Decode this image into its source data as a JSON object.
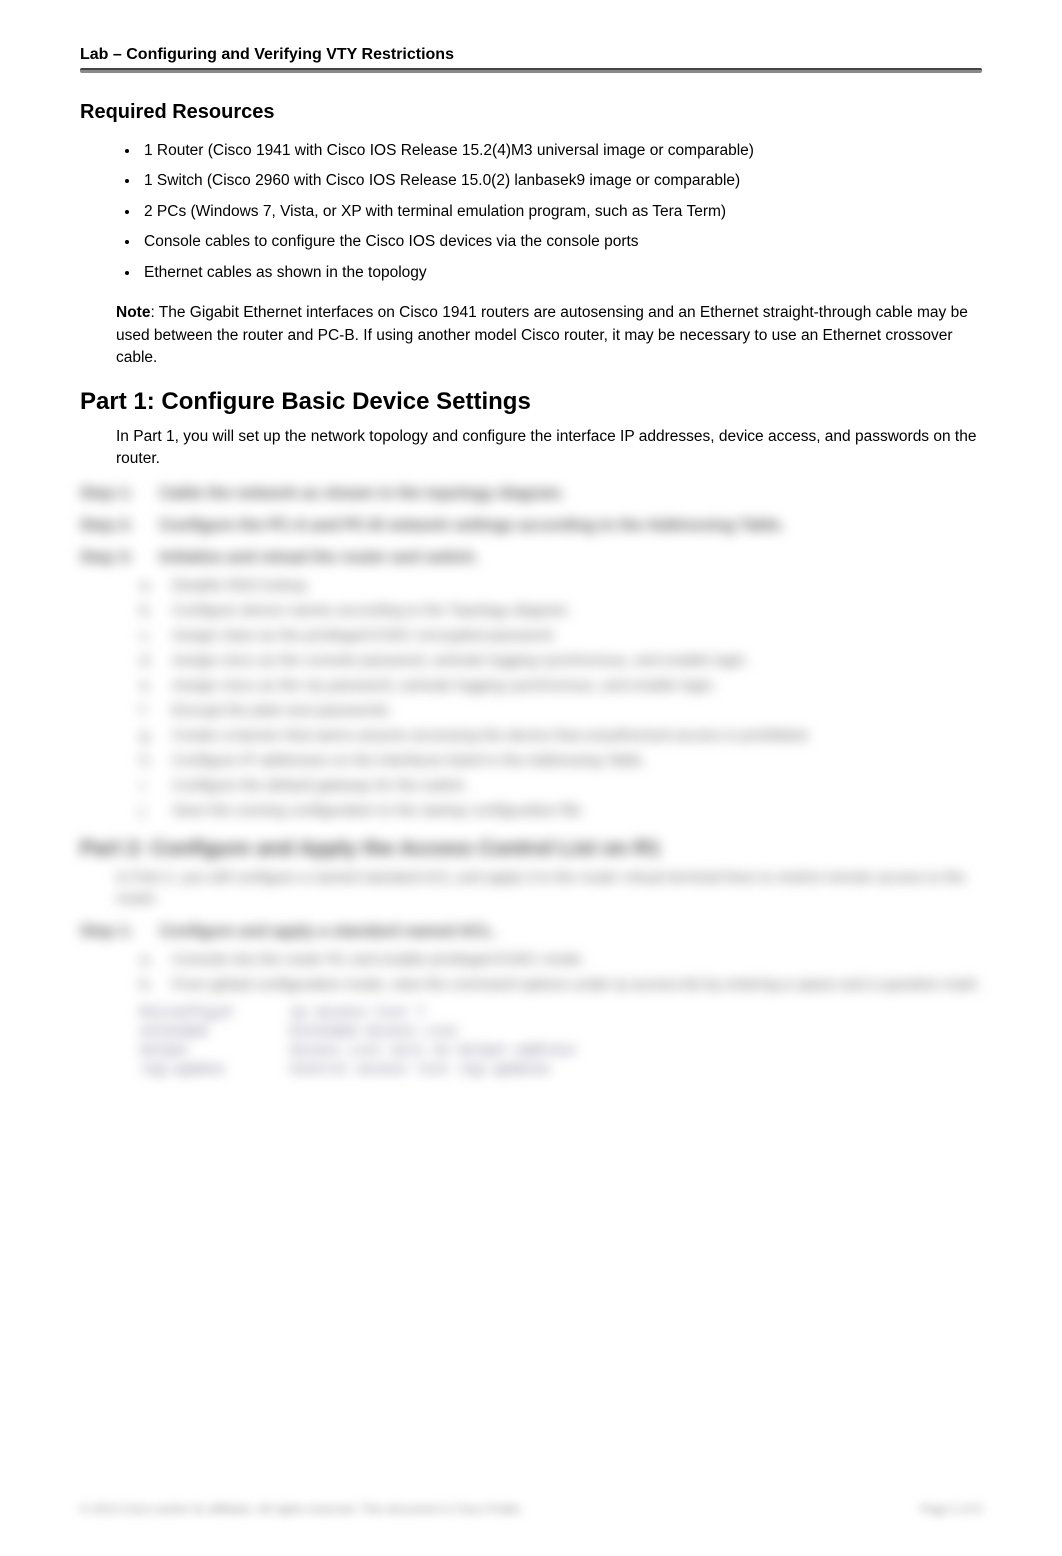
{
  "header": {
    "running_title": "Lab – Configuring and Verifying VTY Restrictions"
  },
  "sections": {
    "resources_heading": "Required Resources",
    "resources": [
      "1 Router (Cisco 1941 with Cisco IOS Release 15.2(4)M3 universal image or comparable)",
      "1 Switch (Cisco 2960 with Cisco IOS Release 15.0(2) lanbasek9 image or comparable)",
      "2 PCs (Windows 7, Vista, or XP with terminal emulation program, such as Tera Term)",
      "Console cables to configure the Cisco IOS devices via the console ports",
      "Ethernet cables as shown in the topology"
    ],
    "note_label": "Note",
    "note_body": ": The Gigabit Ethernet interfaces on Cisco 1941 routers are autosensing and an Ethernet straight-through cable may be used between the router and PC-B. If using another model Cisco router, it may be necessary to use an Ethernet crossover cable.",
    "part1_heading": "Part 1:   Configure Basic Device Settings",
    "part1_body": "In Part 1, you will set up the network topology and configure the interface IP addresses, device access, and passwords on the router."
  },
  "blurred": {
    "steps_a": [
      {
        "label": "Step 1:",
        "text": "Cable the network as shown in the topology diagram."
      },
      {
        "label": "Step 2:",
        "text": "Configure the PC-A and PC-B network settings according to the Addressing Table."
      },
      {
        "label": "Step 3:",
        "text": "Initialize and reload the router and switch."
      }
    ],
    "sub_items": [
      {
        "l": "a.",
        "t": "Disable DNS lookup."
      },
      {
        "l": "b.",
        "t": "Configure device names according to the Topology diagram."
      },
      {
        "l": "c.",
        "t": "Assign class as the privileged EXEC encrypted password."
      },
      {
        "l": "d.",
        "t": "Assign cisco as the console password, activate logging synchronous, and enable login."
      },
      {
        "l": "e.",
        "t": "Assign cisco as the vty password, activate logging synchronous, and enable login."
      },
      {
        "l": "f.",
        "t": "Encrypt the plain text passwords."
      },
      {
        "l": "g.",
        "t": "Create a banner that warns anyone accessing the device that unauthorized access is prohibited."
      },
      {
        "l": "h.",
        "t": "Configure IP addresses on the interfaces listed in the Addressing Table."
      },
      {
        "l": "i.",
        "t": "Configure the default gateway for the switch."
      },
      {
        "l": "j.",
        "t": "Save the running configuration to the startup configuration file."
      }
    ],
    "part2_heading": "Part 2:   Configure and Apply the Access Control List on R1",
    "part2_body": "In Part 2, you will configure a named standard ACL and apply it to the router virtual terminal lines to restrict remote access to the router.",
    "step_b1": {
      "label": "Step 1:",
      "text": "Configure and apply a standard named ACL."
    },
    "sub_items_b": [
      {
        "l": "a.",
        "t": "Console into the router R1 and enable privileged EXEC mode."
      },
      {
        "l": "b.",
        "t": "From global configuration mode, view the command options under ip access-list by entering a space and a question mark."
      }
    ],
    "cli": [
      {
        "c1": "R1(config)#",
        "c2": "ip access-list ?"
      },
      {
        "c1": "  extended",
        "c2": "Extended Access List"
      },
      {
        "c1": "  helper",
        "c2": "Access List acts on helper-address"
      },
      {
        "c1": "  log-update",
        "c2": "Control access list log updates"
      }
    ],
    "footer_left": "© 2013 Cisco and/or its affiliates. All rights reserved. This document is Cisco Public.",
    "footer_right": "Page 2 of 6"
  }
}
